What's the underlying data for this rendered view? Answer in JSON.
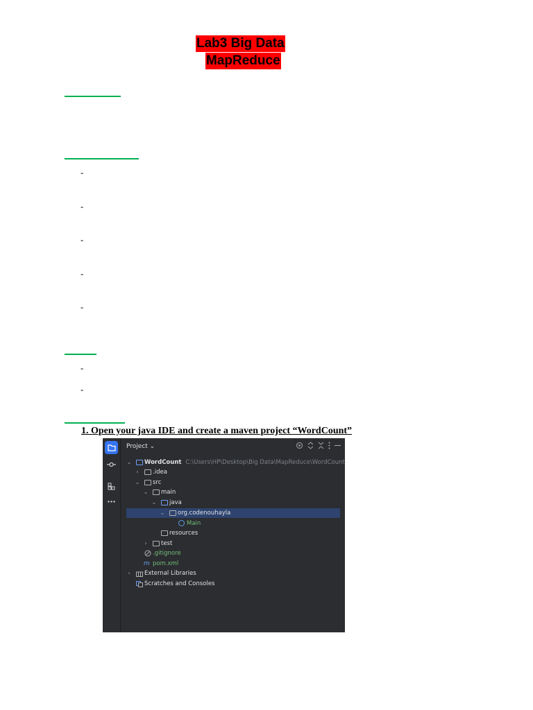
{
  "document": {
    "title_line1": "Lab3 Big Data",
    "title_line2": "MapReduce",
    "dash": "-",
    "step1": "1. Open your java IDE and create a maven project “WordCount”"
  },
  "ide": {
    "panel_title": "Project ⌄",
    "tree": [
      {
        "label": "WordCount",
        "path": "C:\\Users\\HP\\Desktop\\Big Data\\MapReduce\\WordCount"
      },
      {
        "label": ".idea"
      },
      {
        "label": "src"
      },
      {
        "label": "main"
      },
      {
        "label": "java"
      },
      {
        "label": "org.codenouhayla"
      },
      {
        "label": "Main"
      },
      {
        "label": "resources"
      },
      {
        "label": "test"
      },
      {
        "label": ".gitignore"
      },
      {
        "label": "pom.xml"
      },
      {
        "label": "External Libraries"
      },
      {
        "label": "Scratches and Consoles"
      }
    ],
    "colors": {
      "background": "#2b2d30",
      "selection": "#2e436e",
      "accent": "#3574f0",
      "vcs_green": "#73bd79"
    }
  }
}
